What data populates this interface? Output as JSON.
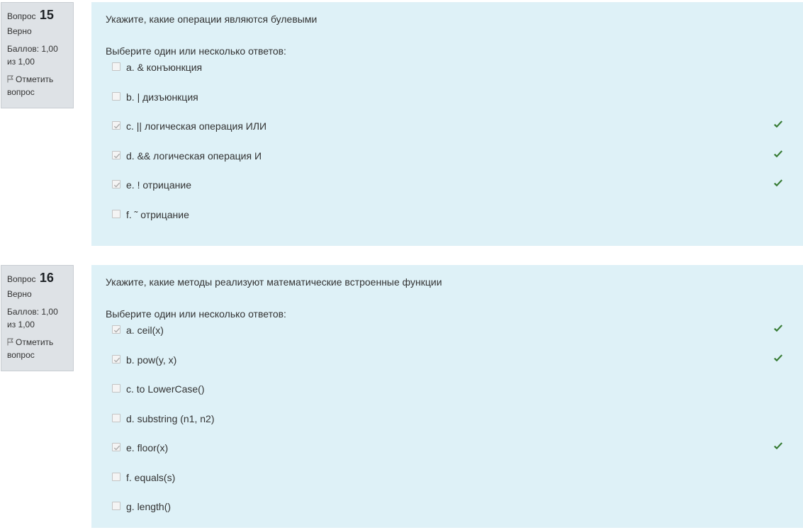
{
  "questions": [
    {
      "number_prefix": "Вопрос",
      "number": "15",
      "state": "Верно",
      "grade": "Баллов: 1,00 из 1,00",
      "flag_label": "Отметить вопрос",
      "text": "Укажите, какие операции являются булевыми",
      "prompt": "Выберите один или несколько ответов:",
      "options": [
        {
          "label": "a. & конъюнкция",
          "checked": false,
          "correct": false
        },
        {
          "label": "b. | дизъюнкция",
          "checked": false,
          "correct": false
        },
        {
          "label": "c. || логическая операция ИЛИ",
          "checked": true,
          "correct": true
        },
        {
          "label": "d. && логическая операция И",
          "checked": true,
          "correct": true
        },
        {
          "label": "e. ! отрицание",
          "checked": true,
          "correct": true
        },
        {
          "label": "f. ˜ отрицание",
          "checked": false,
          "correct": false
        }
      ]
    },
    {
      "number_prefix": "Вопрос",
      "number": "16",
      "state": "Верно",
      "grade": "Баллов: 1,00 из 1,00",
      "flag_label": "Отметить вопрос",
      "text": "Укажите, какие методы реализуют математические встроенные функции",
      "prompt": "Выберите один или несколько ответов:",
      "options": [
        {
          "label": "a. ceil(x)",
          "checked": true,
          "correct": true
        },
        {
          "label": "b. pow(y, x)",
          "checked": true,
          "correct": true
        },
        {
          "label": "c. to LowerCase()",
          "checked": false,
          "correct": false
        },
        {
          "label": "d. substring (n1, n2)",
          "checked": false,
          "correct": false
        },
        {
          "label": "e. floor(x)",
          "checked": true,
          "correct": true
        },
        {
          "label": "f. equals(s)",
          "checked": false,
          "correct": false
        },
        {
          "label": "g. length()",
          "checked": false,
          "correct": false
        }
      ]
    }
  ],
  "colors": {
    "content_bg": "#def1f7",
    "info_bg": "#dee2e6",
    "correct_mark": "#357a32"
  },
  "icons": {
    "flag": "flag-icon",
    "correct": "check-icon",
    "checkbox_checked": "checkbox-checked",
    "checkbox_unchecked": "checkbox-unchecked"
  }
}
